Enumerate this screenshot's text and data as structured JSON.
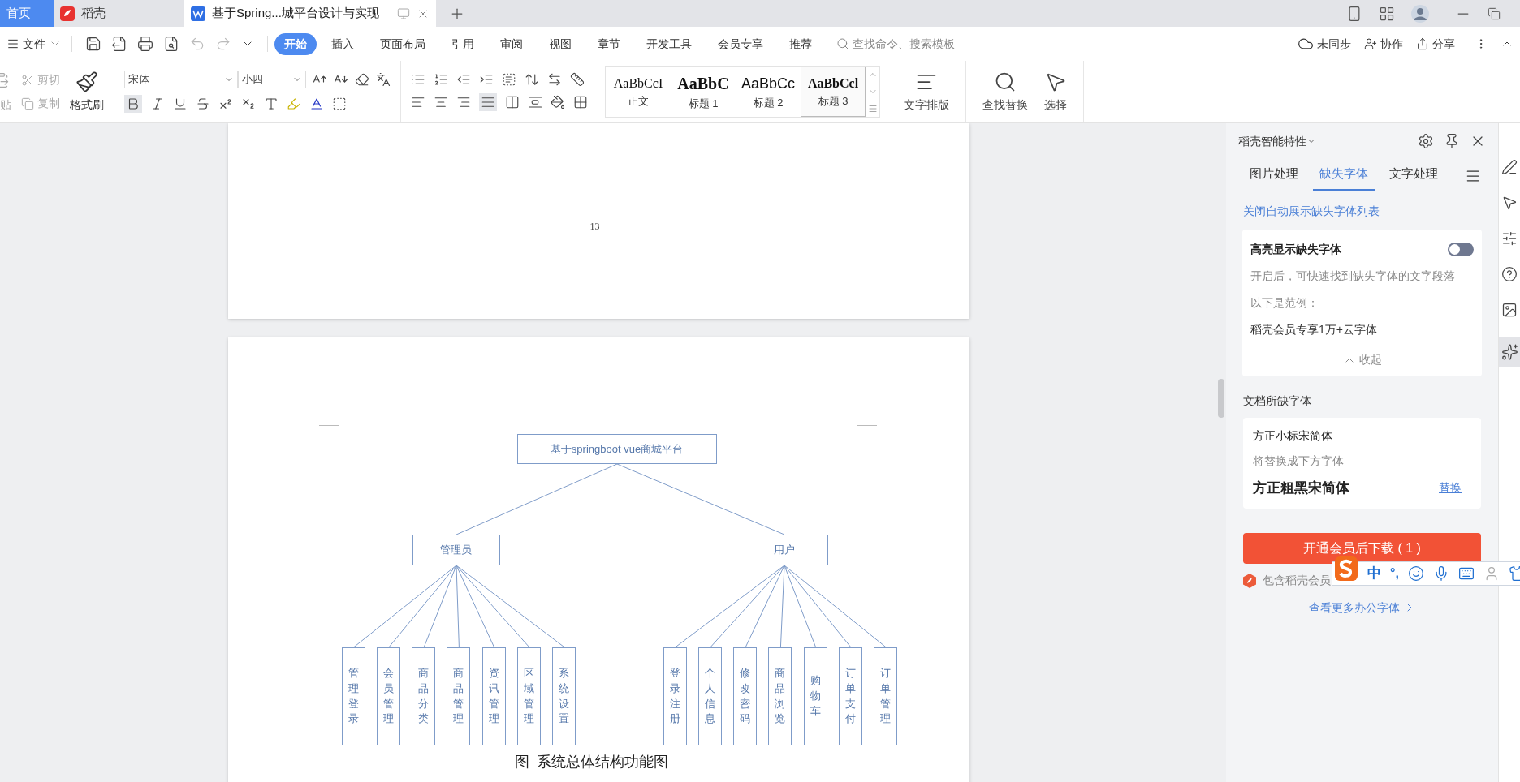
{
  "tabs": [
    {
      "label": "首页",
      "kind": "home",
      "selected": false
    },
    {
      "label": "稻壳",
      "kind": "docer",
      "selected": false
    },
    {
      "label": "基于Spring...城平台设计与实现",
      "kind": "doc",
      "selected": true
    }
  ],
  "menu": {
    "file": "文件",
    "tabs": [
      {
        "label": "开始",
        "selected": true
      },
      {
        "label": "插入",
        "selected": false
      },
      {
        "label": "页面布局",
        "selected": false
      },
      {
        "label": "引用",
        "selected": false
      },
      {
        "label": "审阅",
        "selected": false
      },
      {
        "label": "视图",
        "selected": false
      },
      {
        "label": "章节",
        "selected": false
      },
      {
        "label": "开发工具",
        "selected": false
      },
      {
        "label": "会员专享",
        "selected": false
      },
      {
        "label": "推荐",
        "selected": false
      }
    ],
    "search_placeholder": "查找命令、搜索模板",
    "sync": "未同步",
    "collaborate": "协作",
    "share": "分享"
  },
  "ribbon": {
    "paste": "贴",
    "cut": "剪切",
    "copy": "复制",
    "format_painter": "格式刷",
    "font": "宋体",
    "size": "小四",
    "styles": [
      {
        "sample": "AaBbCcI",
        "label": "正文",
        "kind": "body",
        "selected": false
      },
      {
        "sample": "AaBbC",
        "label": "标题 1",
        "kind": "heading1",
        "selected": false
      },
      {
        "sample": "AaBbCc",
        "label": "标题 2",
        "kind": "heading2",
        "selected": false
      },
      {
        "sample": "AaBbCcl",
        "label": "标题 3",
        "kind": "heading3",
        "selected": true
      }
    ],
    "layout": "文字排版",
    "find": "查找替换",
    "select": "选择"
  },
  "document": {
    "page_number": "13",
    "diagram": {
      "label": "基于springboot vue商城平台",
      "children": [
        {
          "label": "管理员",
          "children": [
            {
              "label": "管理登录"
            },
            {
              "label": "会员管理"
            },
            {
              "label": "商品分类"
            },
            {
              "label": "商品管理"
            },
            {
              "label": "资讯管理"
            },
            {
              "label": "区域管理"
            },
            {
              "label": "系统设置"
            }
          ]
        },
        {
          "label": "用户",
          "children": [
            {
              "label": "登录注册"
            },
            {
              "label": "个人信息"
            },
            {
              "label": "修改密码"
            },
            {
              "label": "商品浏览"
            },
            {
              "label": "购物车"
            },
            {
              "label": "订单支付"
            },
            {
              "label": "订单管理"
            }
          ]
        }
      ]
    },
    "caption": "图  系统总体结构功能图"
  },
  "panel": {
    "title": "稻壳智能特性",
    "tabs": [
      {
        "label": "图片处理",
        "selected": false
      },
      {
        "label": "缺失字体",
        "selected": true
      },
      {
        "label": "文字处理",
        "selected": false
      }
    ],
    "link": "关闭自动展示缺失字体列表",
    "highlight": {
      "title": "高亮显示缺失字体",
      "on": false,
      "description": "开启后，可快速找到缺失字体的文字段落",
      "example_label": "以下是范例：",
      "example": "稻壳会员专享1万+云字体",
      "collapse": "收起"
    },
    "missing_title": "文档所缺字体",
    "missing": [
      {
        "font": "方正小标宋简体",
        "hint": "将替换成下方字体",
        "replacement": "方正粗黑宋简体",
        "action": "替换"
      }
    ],
    "download": "开通会员后下载 ( 1 )",
    "includes": "包含稻壳会员",
    "more": "查看更多办公字体"
  },
  "ime": {
    "mode": "中",
    "punctuation": "°,"
  }
}
